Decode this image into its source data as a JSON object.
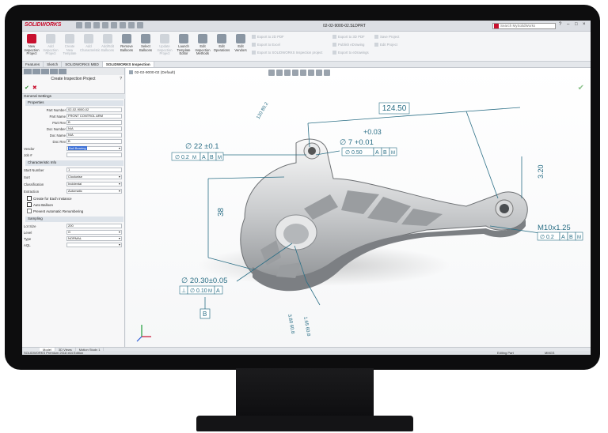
{
  "app": {
    "brand": "SOLIDWORKS",
    "doc_title": "02-02-9000-02.SLDPRT",
    "search_placeholder": "Search MySolidWorks"
  },
  "window_controls": [
    "?",
    "–",
    "□",
    "×"
  ],
  "ribbon": {
    "buttons": [
      "New Inspection Project",
      "Add Inspection Project",
      "Create New Template",
      "Add Characteristic",
      "Add/Edit Balloons",
      "Remove Balloons",
      "Select Balloons",
      "Update Inspection Project",
      "Launch Template Editor",
      "Edit Inspection Methods",
      "Edit Operations",
      "Edit Vendors"
    ],
    "small_left": [
      "Export to 2D PDF",
      "Export to Excel",
      "Export to SOLIDWORKS Inspection project"
    ],
    "small_mid": [
      "Export to 3D PDF",
      "Publish eDrawing",
      "Export to eDrawings"
    ],
    "small_right": [
      "Save Project",
      "Edit Project"
    ]
  },
  "tabs": [
    "Features",
    "Sketch",
    "SOLIDWORKS MBD",
    "SOLIDWORKS Inspection"
  ],
  "panel": {
    "title": "Create Inspection Project",
    "help": "?",
    "general_settings": "General Settings",
    "properties": "Properties",
    "fields": [
      {
        "label": "Part Number",
        "value": "02-02-9000-02"
      },
      {
        "label": "Part Name",
        "value": "FRONT CONTROL ARM"
      },
      {
        "label": "Part Rev",
        "value": "B"
      },
      {
        "label": "Doc Number",
        "value": "N/A"
      },
      {
        "label": "Doc Name",
        "value": "N/A"
      },
      {
        "label": "Doc Rev",
        "value": "B"
      }
    ],
    "vendor_label": "Vendor",
    "vendor_value": "Ball Bearing",
    "job_label": "Job #",
    "char_info": "Characteristic Info",
    "start_label": "Start Number",
    "start_value": "1",
    "sort_label": "Sort",
    "sort_value": "Clockwise",
    "class_label": "Classification",
    "class_value": "Incidental",
    "extract_label": "Extraction",
    "extract_value": "Automatic",
    "checks": [
      "Create for Each Instance",
      "Auto Balloon",
      "Prevent Automatic Renumbering"
    ],
    "sampling": "Sampling",
    "lot_label": "Lot Size",
    "lot_value": "200",
    "level_label": "Level",
    "level_value": "G",
    "type_label": "Type",
    "type_value": "NORMAL",
    "aql_label": "AQL",
    "aql_value": ""
  },
  "viewport": {
    "tree_label": "02-02-9000-02 (Default)",
    "dims": {
      "d124": "124.50",
      "d22": "∅ 22 ±0.1",
      "d003": "+0.03",
      "d7": "∅ 7 +0.01",
      "fcf1_tol": "∅ 0.2",
      "fcf1_m": "M",
      "fcf1_a": "A",
      "fcf1_b": "B",
      "fcf1_m2": "M",
      "fcf2_tol": "∅ 0.50",
      "fcf2_a": "A",
      "fcf2_b": "B",
      "fcf2_m": "M",
      "d38": "38",
      "d320": "3.20",
      "m10": "M10x1.25",
      "fcf3_tol": "∅ 0.2",
      "fcf3_a": "A",
      "fcf3_b": "B",
      "fcf3_m": "M",
      "d2030": "∅ 20.30±0.05",
      "fcf4_perp": "⊥",
      "fcf4_tol": "∅ 0.10",
      "fcf4_m": "M",
      "fcf4_a": "A",
      "datum_b": "B",
      "tilt1": "120 80.2",
      "tilt2": "3.80 60.8",
      "tilt3": "1.65 60.8"
    }
  },
  "bottom_tabs": [
    "Model",
    "3D Views",
    "Motion Study 1"
  ],
  "status": {
    "left": "SOLIDWORKS Premium 2018 x64 Edition",
    "mode": "Editing Part",
    "units": "MMGS"
  },
  "colors": {
    "accent": "#c8102e",
    "dim_line": "#2b6f86",
    "selection": "#3b6fd6"
  }
}
